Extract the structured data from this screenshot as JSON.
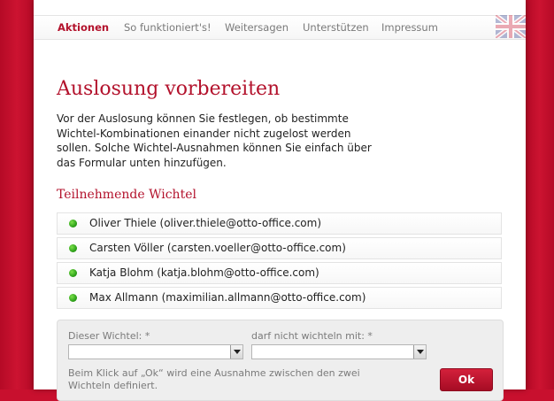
{
  "nav": {
    "items": [
      {
        "label": "Aktionen",
        "active": true
      },
      {
        "label": "So funktioniert's!",
        "active": false
      },
      {
        "label": "Weitersagen",
        "active": false
      },
      {
        "label": "Unterstützen",
        "active": false
      },
      {
        "label": "Impressum",
        "active": false
      }
    ],
    "language_icon": "uk-flag-icon"
  },
  "page": {
    "title": "Auslosung vorbereiten",
    "intro": "Vor der Auslosung können Sie festlegen, ob bestimmte Wichtel-Kombinationen einander nicht zugelost werden sollen. Solche Wichtel-Ausnahmen können Sie einfach über das Formular unten hinzufügen."
  },
  "participants": {
    "heading": "Teilnehmende Wichtel",
    "status_icon": "green-dot-icon",
    "items": [
      {
        "label": "Oliver Thiele (oliver.thiele@otto-office.com)"
      },
      {
        "label": "Carsten Völler (carsten.voeller@otto-office.com)"
      },
      {
        "label": "Katja Blohm (katja.blohm@otto-office.com)"
      },
      {
        "label": "Max Allmann (maximilian.allmann@otto-office.com)"
      }
    ]
  },
  "form": {
    "field1_label": "Dieser Wichtel: *",
    "field1_value": "",
    "field2_label": "darf nicht wichteln mit: *",
    "field2_value": "",
    "hint": "Beim Klick auf „Ok“ wird eine Ausnahme zwischen den zwei Wichteln definiert.",
    "ok_label": "Ok"
  },
  "colors": {
    "brand_red": "#b3122c",
    "background_red": "#c8102e",
    "status_green": "#2fa31a"
  }
}
